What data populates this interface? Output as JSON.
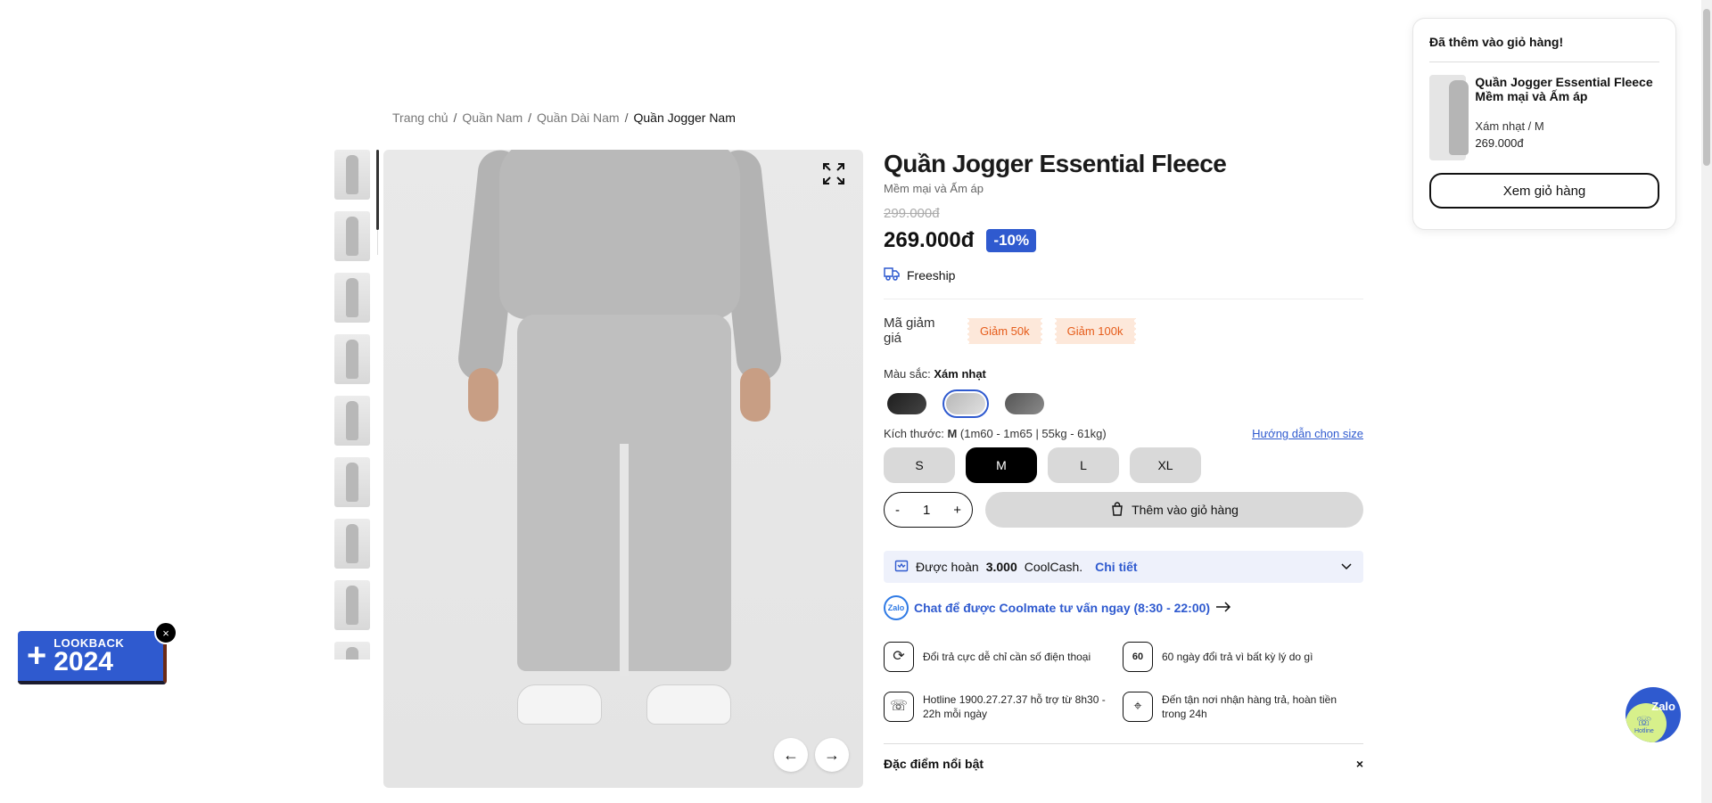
{
  "breadcrumb": {
    "items": [
      "Trang chủ",
      "Quần Nam",
      "Quần Dài Nam"
    ],
    "current": "Quần Jogger Nam",
    "separator": "/"
  },
  "gallery": {
    "thumbnail_count": 9,
    "expand_icon": "expand-icon",
    "prev_icon": "arrow-left-icon",
    "next_icon": "arrow-right-icon",
    "prev_glyph": "←",
    "next_glyph": "→"
  },
  "product": {
    "title": "Quần Jogger Essential Fleece",
    "subtitle": "Mềm mại và Ấm áp",
    "old_price": "299.000đ",
    "price": "269.000đ",
    "discount": "-10%",
    "freeship": "Freeship",
    "coupon_label": "Mã giảm giá",
    "coupons": [
      "Giảm 50k",
      "Giảm 100k"
    ],
    "color_label": "Màu sắc:",
    "color_selected": "Xám nhạt",
    "colors": [
      "#2b2b2b",
      "#c8c8c8",
      "#6f6f6f"
    ],
    "size_label": "Kích thước:",
    "size_selected": "M",
    "size_detail": "(1m60 - 1m65 | 55kg - 61kg)",
    "size_guide": "Hướng dẫn chọn size",
    "sizes": [
      "S",
      "M",
      "L",
      "XL"
    ],
    "qty_minus": "-",
    "qty_value": "1",
    "qty_plus": "+",
    "add_to_cart": "Thêm vào giỏ hàng",
    "coolcash_prefix": "Được hoàn",
    "coolcash_amount": "3.000",
    "coolcash_suffix": "CoolCash.",
    "coolcash_link": "Chi tiết",
    "zalo_badge": "Zalo",
    "zalo_chat": "Chat để được Coolmate tư vấn ngay (8:30 - 22:00)",
    "policies": [
      {
        "icon": "exchange-icon",
        "glyph": "⟳",
        "text": "Đổi trả cực dễ chỉ cần số điện thoại"
      },
      {
        "icon": "sixty-days-icon",
        "glyph": "60",
        "text": "60 ngày đổi trả vì bất kỳ lý do gì"
      },
      {
        "icon": "phone-icon",
        "glyph": "☏",
        "text": "Hotline 1900.27.27.37 hỗ trợ từ 8h30 - 22h mỗi ngày"
      },
      {
        "icon": "location-icon",
        "glyph": "⌖",
        "text": "Đến tận nơi nhận hàng trả, hoàn tiền trong 24h"
      }
    ],
    "highlights_title": "Đặc điểm nổi bật",
    "highlights_close": "×"
  },
  "cart_popup": {
    "title": "Đã thêm vào giỏ hàng!",
    "item_name": "Quần Jogger Essential Fleece Mềm mại và Ấm áp",
    "item_variant": "Xám nhạt / M",
    "item_price": "269.000đ",
    "view_cart": "Xem giỏ hàng"
  },
  "lookback": {
    "label": "LOOKBACK",
    "year": "2024",
    "plus": "+",
    "close": "×"
  },
  "zalo_float": {
    "label": "Zalo",
    "sub": "Hotline",
    "glyph": "☏"
  },
  "colors": {
    "accent": "#2f5acf",
    "coupon_bg": "#fde8da",
    "coupon_text": "#e65c1a"
  }
}
